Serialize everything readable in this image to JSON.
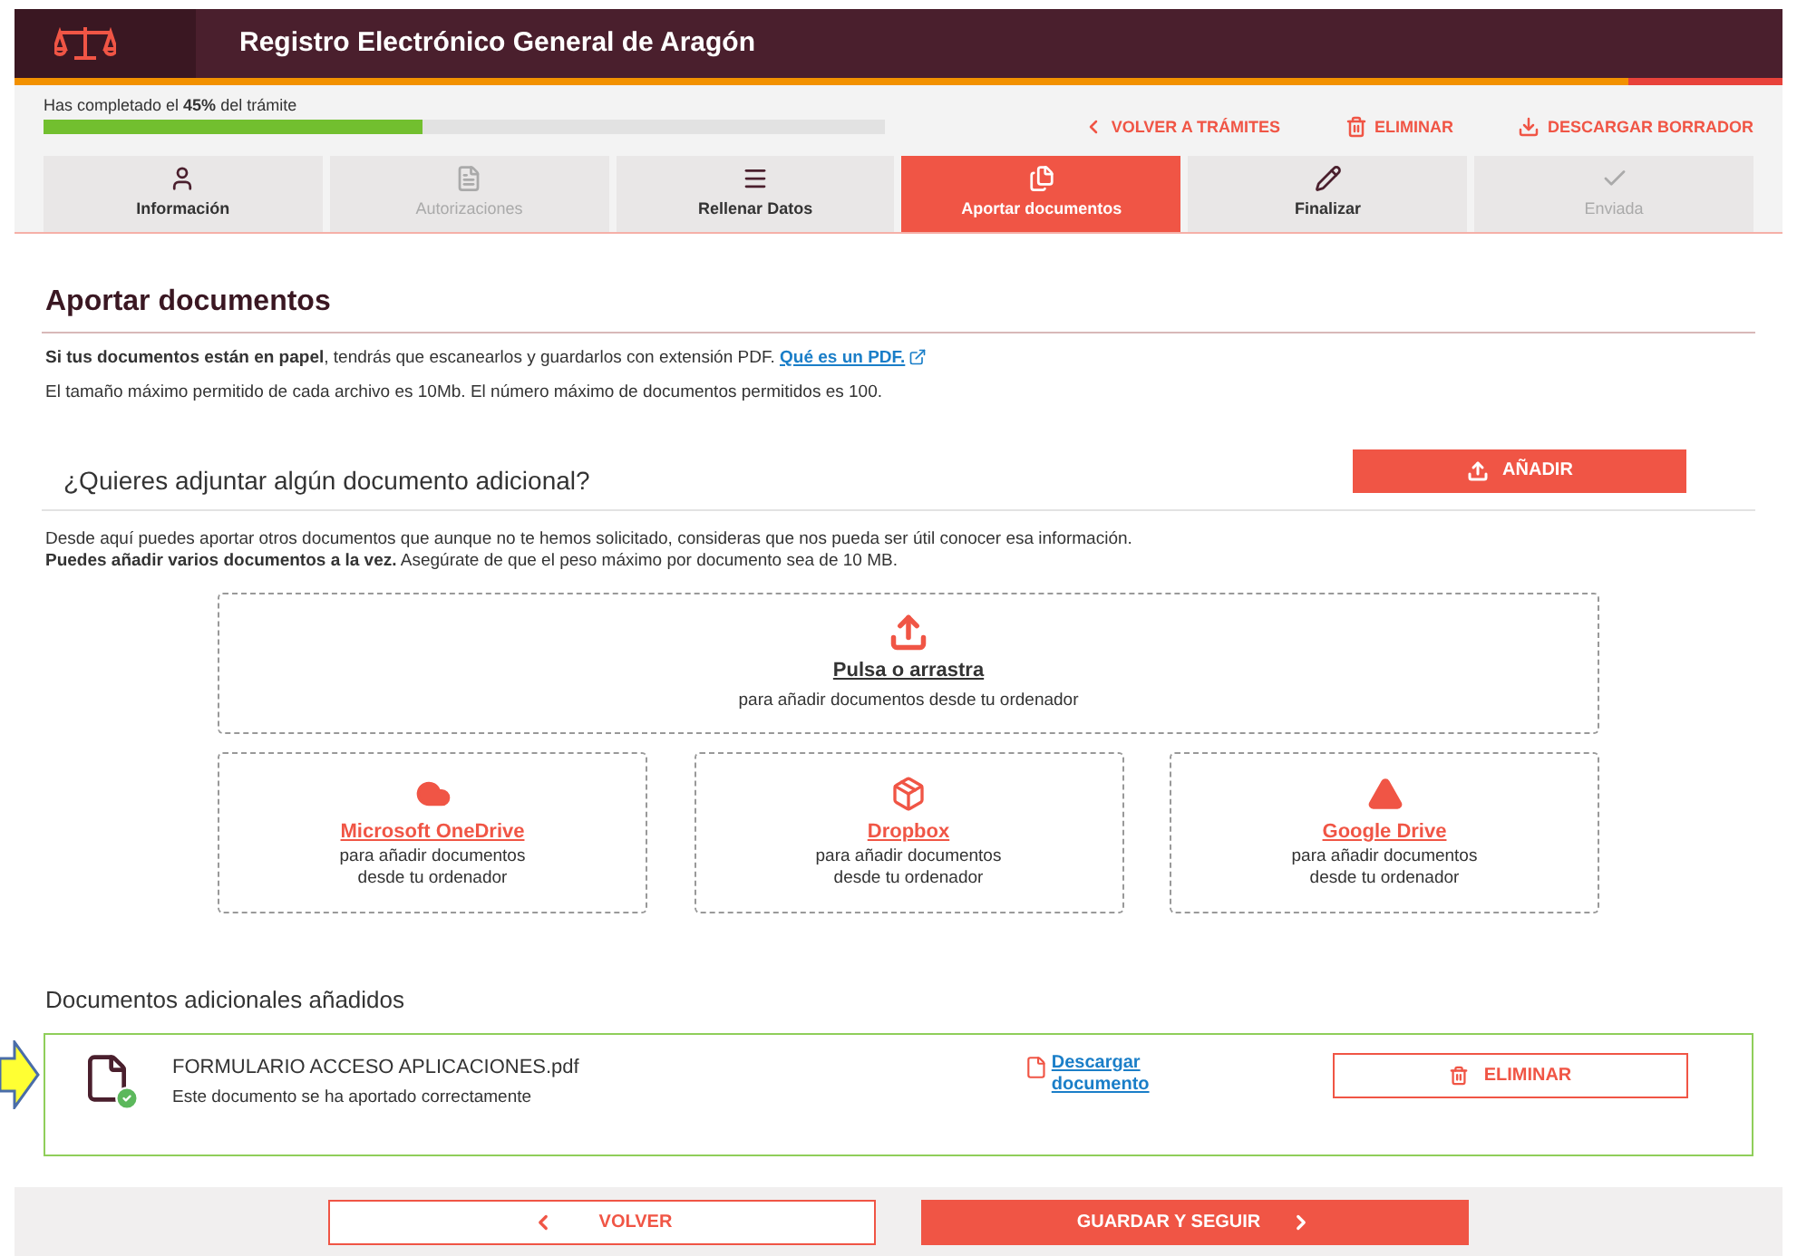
{
  "header": {
    "title": "Registro Electrónico General de Aragón"
  },
  "progress": {
    "label": "Has completado el **45%** del trámite",
    "level": 0.45
  },
  "actions": [
    {
      "label": "VOLVER A TRÁMITES",
      "kind": "back"
    },
    {
      "label": "ELIMINAR",
      "kind": "delete"
    },
    {
      "label": "DESCARGAR BORRADOR",
      "kind": "download"
    }
  ],
  "steps": [
    {
      "label": "Información",
      "kind": "user",
      "selected": false,
      "disabled": false
    },
    {
      "label": "Autorizaciones",
      "kind": "form",
      "selected": false,
      "disabled": true
    },
    {
      "label": "Rellenar Datos",
      "kind": "lines",
      "selected": false,
      "disabled": false
    },
    {
      "label": "Aportar documentos",
      "kind": "docs",
      "selected": true,
      "disabled": false
    },
    {
      "label": "Finalizar",
      "kind": "pencil",
      "selected": false,
      "disabled": false
    },
    {
      "label": "Enviada",
      "kind": "check",
      "selected": false,
      "disabled": true
    }
  ],
  "section_title": "Aportar documentos",
  "intro": {
    "text": "**Si tus documentos están en papel**, tendrás que escanearlos y guardarlos con extensión PDF.",
    "link": "Qué es un PDF."
  },
  "limits": "El tamaño máximo permitido de cada archivo es 10Mb. El número máximo de documentos permitidos es 100.",
  "additional": {
    "question": "¿Quieres adjuntar algún documento adicional?",
    "button": "AÑADIR",
    "description": "Desde aquí puedes aportar otros documentos que aunque no te hemos solicitado, consideras que nos pueda ser útil conocer esa información.",
    "note": "**Puedes añadir varios documentos a la vez.** Asegúrate de que el peso máximo por documento sea de 10 MB."
  },
  "dropzone": {
    "title": "Pulsa o arrastra",
    "subtitle": "para añadir documentos desde tu ordenador"
  },
  "sources": [
    {
      "kind": "onedrive",
      "title": "Microsoft OneDrive",
      "subtitle": "para añadir documentos desde tu ordenador"
    },
    {
      "kind": "dropbox",
      "title": "Dropbox",
      "subtitle": "para añadir documentos desde tu ordenador"
    },
    {
      "kind": "gdrive",
      "title": "Google Drive",
      "subtitle": "para añadir documentos desde tu ordenador"
    }
  ],
  "added_title": "Documentos adicionales añadidos",
  "files": [
    {
      "name": "FORMULARIO ACCESO APLICACIONES.pdf",
      "status": "Este documento se ha aportado correctamente",
      "download": "Descargar documento",
      "delete": "ELIMINAR"
    }
  ],
  "footer": {
    "back": "VOLVER",
    "next": "GUARDAR Y SEGUIR"
  }
}
